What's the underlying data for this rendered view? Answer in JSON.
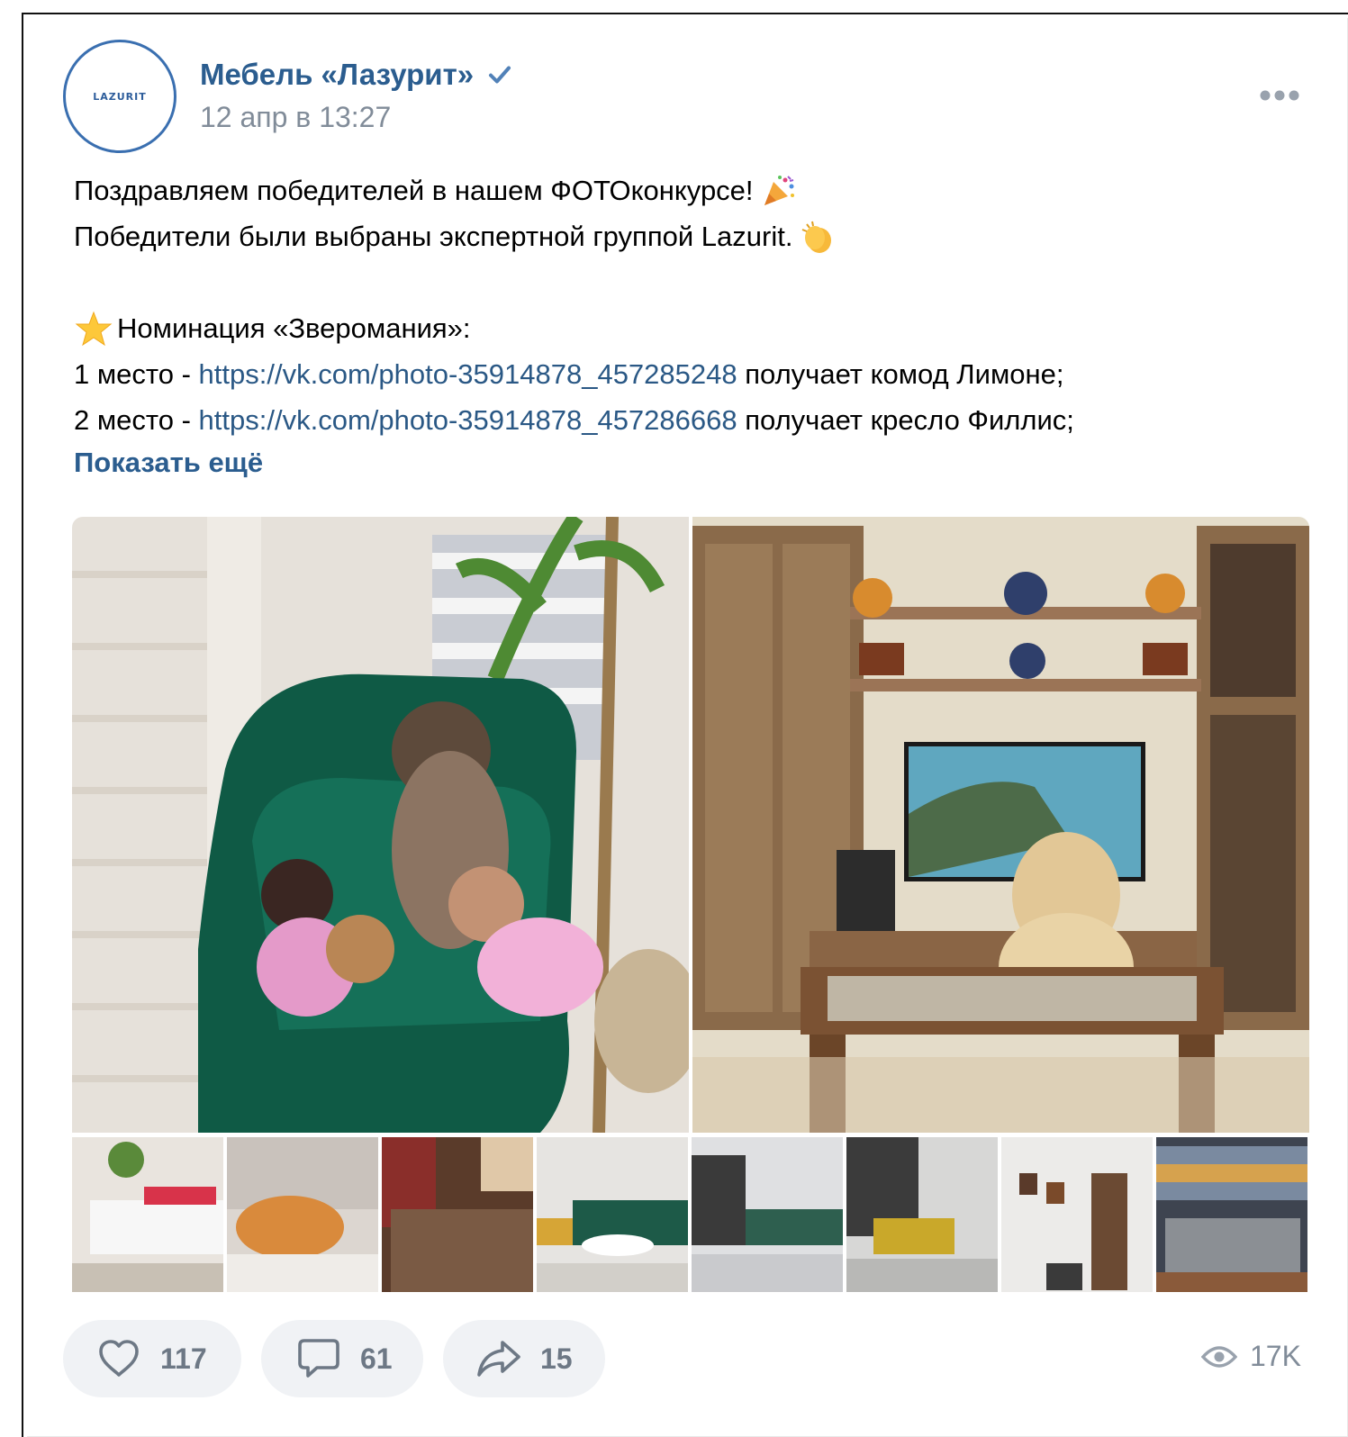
{
  "post": {
    "author": "Мебель «Лазурит»",
    "avatar_logo_text": "LAZURIT",
    "date": "12 апр в 13:27",
    "text_lines": {
      "l1": "Поздравляем победителей в нашем ФОТОконкурсе!",
      "l2": "Победители были выбраны экспертной группой Lazurit.",
      "l3": "Номинация «Зверомания»:",
      "l4_prefix": "1 место - ",
      "l4_link": "https://vk.com/photo-35914878_457285248",
      "l4_suffix": " получает комод Лимоне;",
      "l5_prefix": "2 место - ",
      "l5_link": "https://vk.com/photo-35914878_457286668",
      "l5_suffix": " получает кресло Филлис;"
    },
    "show_more": "Показать ещё",
    "photo_count": 10
  },
  "actions": {
    "likes": "117",
    "comments": "61",
    "shares": "15",
    "views": "17K"
  },
  "colors": {
    "link": "#2a5885",
    "author": "#2b5d8f",
    "muted": "#818c99",
    "button_bg": "#f0f2f5"
  },
  "icons": [
    "verified-check-icon",
    "more-dots-icon",
    "party-popper-icon",
    "clapping-hands-icon",
    "star-icon",
    "heart-icon",
    "comment-icon",
    "share-icon",
    "eye-icon"
  ]
}
